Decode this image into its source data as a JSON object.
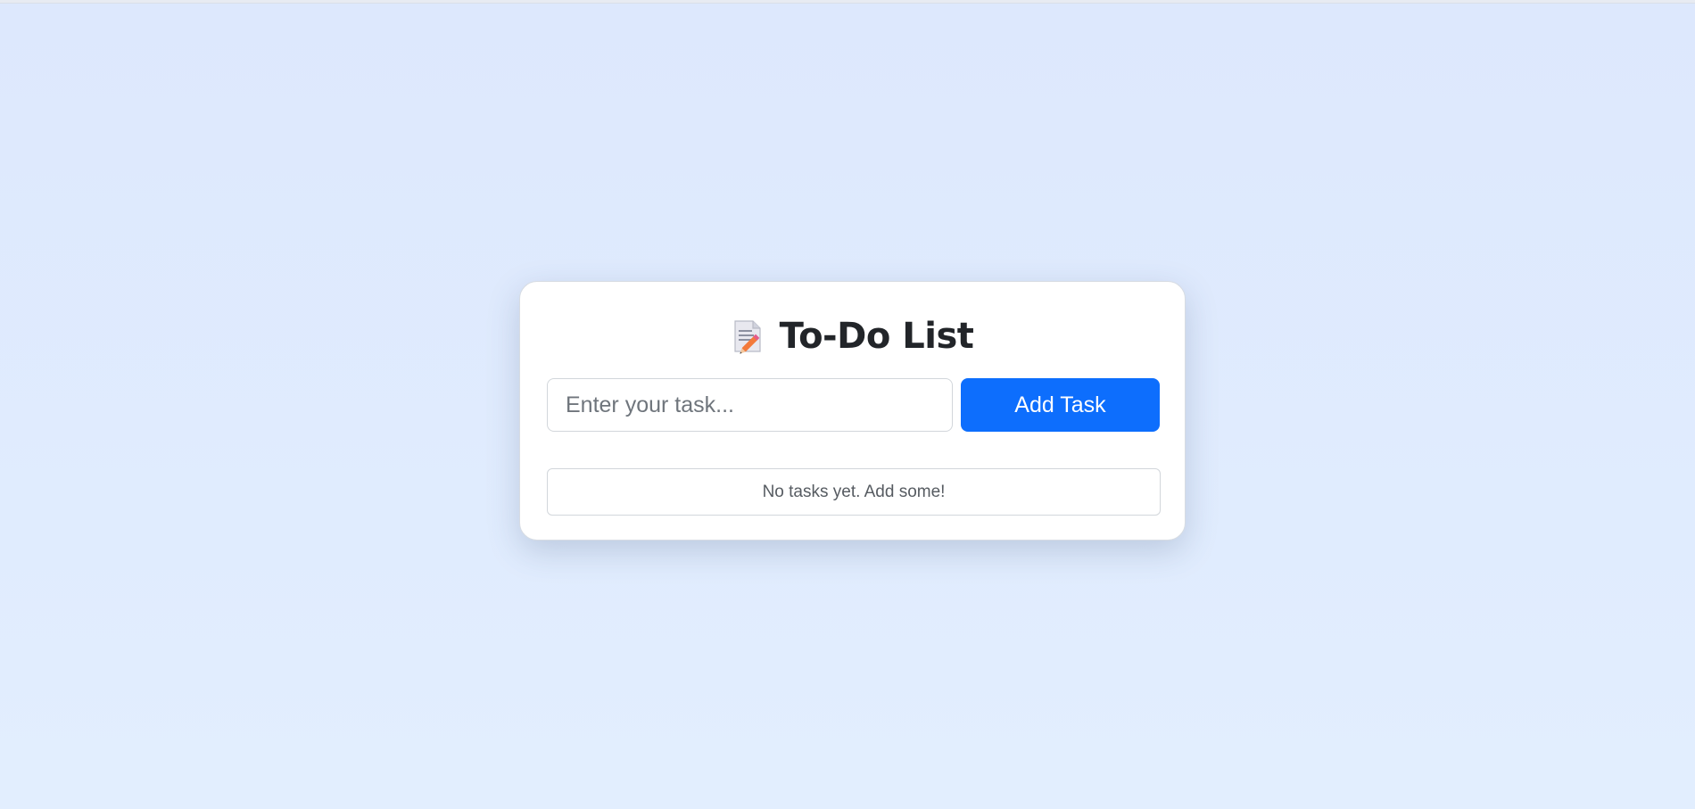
{
  "app": {
    "title": "To-Do List",
    "title_icon": "memo-pencil-icon"
  },
  "form": {
    "input_value": "",
    "input_placeholder": "Enter your task...",
    "add_button_label": "Add Task"
  },
  "task_list": {
    "items": [],
    "empty_message": "No tasks yet. Add some!"
  },
  "colors": {
    "page_background": "#dde8fd",
    "card_background": "#ffffff",
    "primary_button": "#0d6efd",
    "title_text": "#222529"
  }
}
